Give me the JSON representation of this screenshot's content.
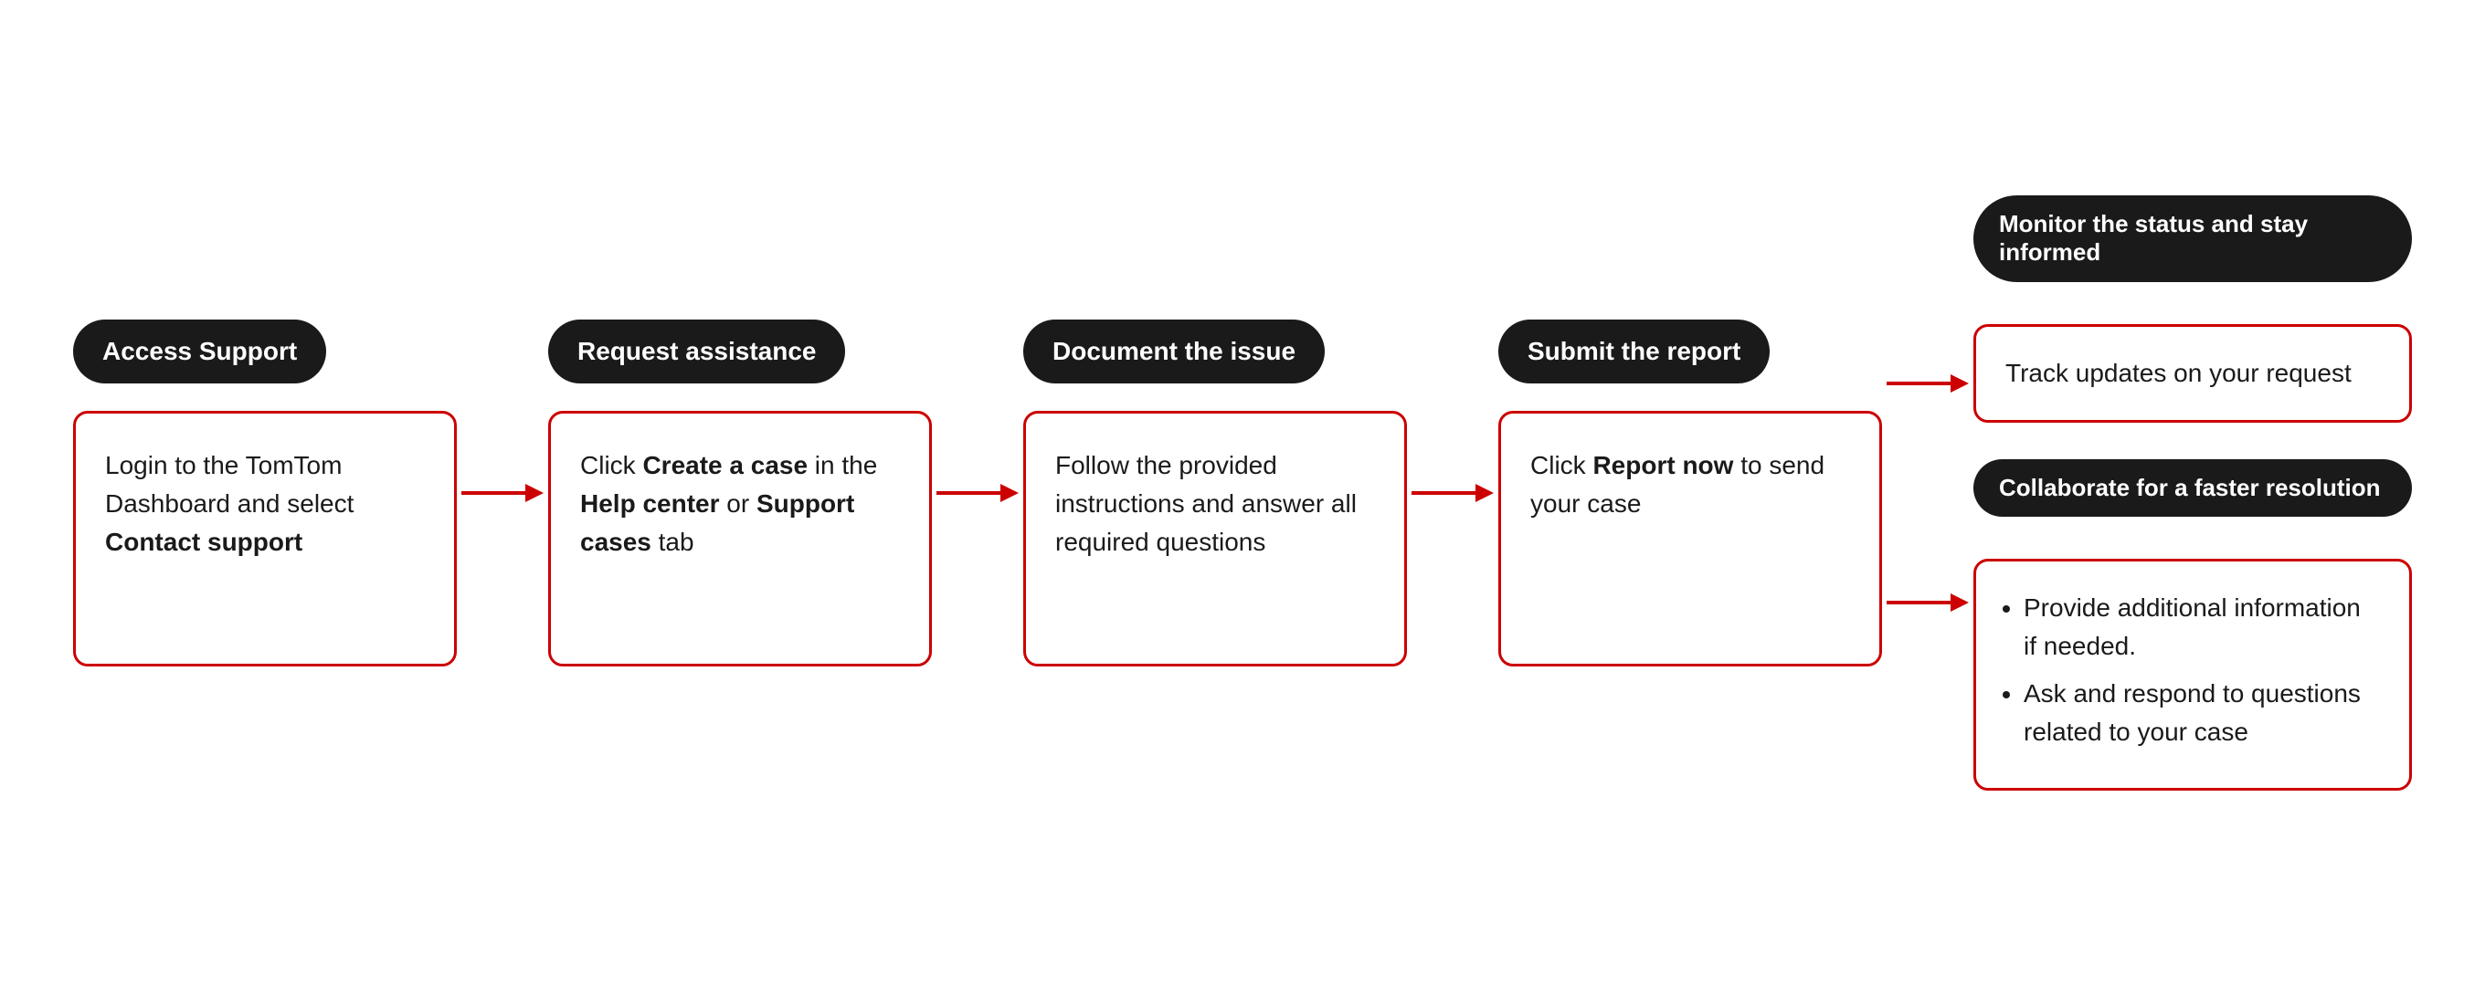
{
  "steps": [
    {
      "id": "access-support",
      "badge": "Access Support",
      "body_html": "Login to the TomTom Dashboard and select <strong>Contact support</strong>"
    },
    {
      "id": "request-assistance",
      "badge": "Request assistance",
      "body_html": "Click <strong>Create a case</strong> in the <strong>Help center</strong> or <strong>Support cases</strong> tab"
    },
    {
      "id": "document-issue",
      "badge": "Document the issue",
      "body_html": "Follow the provided instructions and answer all required questions"
    },
    {
      "id": "submit-report",
      "badge": "Submit the report",
      "body_html": "Click <strong>Report now</strong> to send your case"
    }
  ],
  "last_col": [
    {
      "id": "monitor-status",
      "badge": "Monitor the status and stay informed",
      "body_html": "Track updates on your request"
    },
    {
      "id": "collaborate",
      "badge": "Collaborate for a faster resolution",
      "body_html": "<ul><li>Provide additional information if needed.</li><li>Ask and respond to questions related to your case</li></ul>"
    }
  ],
  "arrow_color": "#cc0000"
}
